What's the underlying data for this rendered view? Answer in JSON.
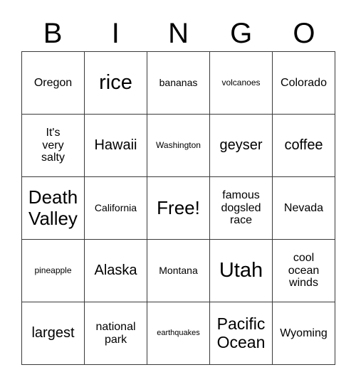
{
  "card": {
    "title_letters": [
      "B",
      "I",
      "N",
      "G",
      "O"
    ],
    "free_space_label": "Free!",
    "grid_line_color": "#3a3a3a",
    "background_color": "#ffffff",
    "text_color": "#000000",
    "rows": [
      [
        {
          "text": "Oregon",
          "size": "md"
        },
        {
          "text": "rice",
          "size": "3xl"
        },
        {
          "text": "bananas",
          "size": "smd"
        },
        {
          "text": "volcanoes",
          "size": "sm"
        },
        {
          "text": "Colorado",
          "size": "md"
        }
      ],
      [
        {
          "text": "It's\nvery\nsalty",
          "size": "md"
        },
        {
          "text": "Hawaii",
          "size": "lg"
        },
        {
          "text": "Washington",
          "size": "sm"
        },
        {
          "text": "geyser",
          "size": "lg"
        },
        {
          "text": "coffee",
          "size": "lg"
        }
      ],
      [
        {
          "text": "Death\nValley",
          "size": "2xl"
        },
        {
          "text": "California",
          "size": "smd"
        },
        {
          "text": "Free!",
          "size": "2xl"
        },
        {
          "text": "famous\ndogsled\nrace",
          "size": "md"
        },
        {
          "text": "Nevada",
          "size": "md"
        }
      ],
      [
        {
          "text": "pineapple",
          "size": "sm"
        },
        {
          "text": "Alaska",
          "size": "lg"
        },
        {
          "text": "Montana",
          "size": "smd"
        },
        {
          "text": "Utah",
          "size": "3xl"
        },
        {
          "text": "cool\nocean\nwinds",
          "size": "md"
        }
      ],
      [
        {
          "text": "largest",
          "size": "lg"
        },
        {
          "text": "national\npark",
          "size": "md"
        },
        {
          "text": "earthquakes",
          "size": "xs"
        },
        {
          "text": "Pacific\nOcean",
          "size": "xl"
        },
        {
          "text": "Wyoming",
          "size": "md"
        }
      ]
    ]
  }
}
